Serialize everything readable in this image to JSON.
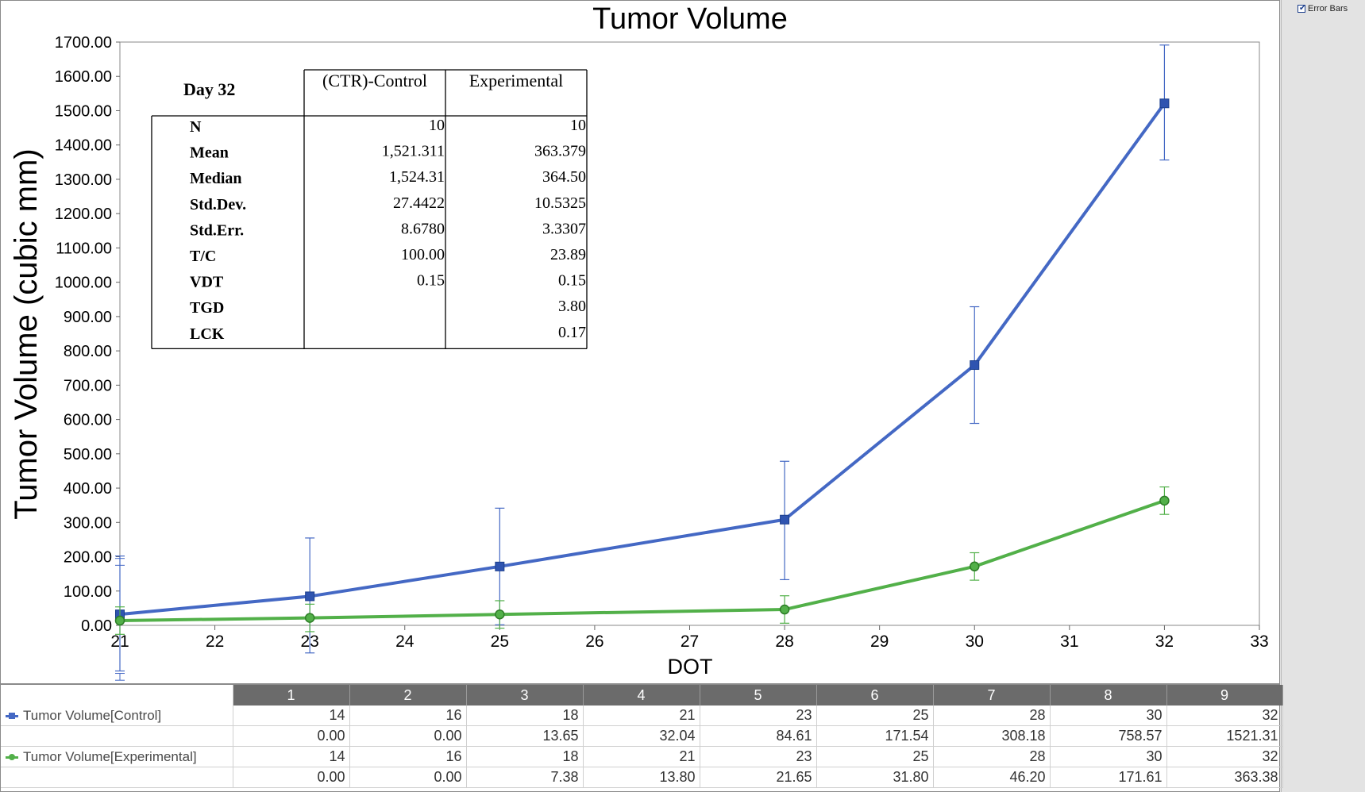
{
  "chart_data": {
    "type": "line",
    "title": "Tumor Volume",
    "xlabel": "DOT",
    "ylabel": "Tumor Volume (cubic mm)",
    "xlim": [
      21,
      33
    ],
    "ylim": [
      0,
      1700
    ],
    "x_ticks": [
      "21",
      "22",
      "23",
      "24",
      "25",
      "26",
      "27",
      "28",
      "29",
      "30",
      "31",
      "32",
      "33"
    ],
    "y_ticks": [
      "0.00",
      "100.00",
      "200.00",
      "300.00",
      "400.00",
      "500.00",
      "600.00",
      "700.00",
      "800.00",
      "900.00",
      "1000.00",
      "1100.00",
      "1200.00",
      "1300.00",
      "1400.00",
      "1500.00",
      "1600.00",
      "1700.00"
    ],
    "grid": false,
    "series": [
      {
        "name": "Tumor Volume[Control]",
        "color": "#4468c4",
        "marker": "square",
        "x": [
          21,
          23,
          25,
          28,
          30,
          32
        ],
        "y": [
          32.04,
          84.61,
          171.54,
          308.18,
          758.57,
          1521.31
        ],
        "error_bars": [
          [
            -165,
            170
          ],
          [
            -165,
            170
          ],
          [
            -170,
            170
          ],
          [
            -175,
            170
          ],
          [
            -170,
            170
          ],
          [
            -165,
            170
          ]
        ]
      },
      {
        "name": "Tumor Volume[Experimental]",
        "color": "#52b049",
        "marker": "circle",
        "x": [
          21,
          23,
          25,
          28,
          30,
          32
        ],
        "y": [
          13.8,
          21.65,
          31.8,
          46.2,
          171.61,
          363.38
        ],
        "error_bars": [
          [
            -40,
            40
          ],
          [
            -40,
            40
          ],
          [
            -40,
            40
          ],
          [
            -40,
            40
          ],
          [
            -40,
            40
          ],
          [
            -40,
            40
          ]
        ]
      }
    ],
    "extra_error_bars_at_x21": [
      {
        "y": 185,
        "err": [
          -10,
          10
        ]
      },
      {
        "y": -150,
        "err": [
          -10,
          10
        ]
      }
    ]
  },
  "stats_table": {
    "title": "Day 32",
    "columns": [
      "(CTR)-Control",
      "Experimental"
    ],
    "rows": [
      {
        "label": "N",
        "values": [
          "10",
          "10"
        ]
      },
      {
        "label": "Mean",
        "values": [
          "1,521.311",
          "363.379"
        ]
      },
      {
        "label": "Median",
        "values": [
          "1,524.31",
          "364.50"
        ]
      },
      {
        "label": "Std.Dev.",
        "values": [
          "27.4422",
          "10.5325"
        ]
      },
      {
        "label": "Std.Err.",
        "values": [
          "8.6780",
          "3.3307"
        ]
      },
      {
        "label": "T/C",
        "values": [
          "100.00",
          "23.89"
        ]
      },
      {
        "label": "VDT",
        "values": [
          "0.15",
          "0.15"
        ]
      },
      {
        "label": "TGD",
        "values": [
          "",
          "3.80"
        ]
      },
      {
        "label": "LCK",
        "values": [
          "",
          "0.17"
        ]
      }
    ]
  },
  "controls": {
    "error_bars_label": "Error Bars",
    "error_bars_checked": true
  },
  "data_grid": {
    "columns": [
      "1",
      "2",
      "3",
      "4",
      "5",
      "6",
      "7",
      "8",
      "9"
    ],
    "rows": [
      {
        "series_label": "Tumor Volume[Control]",
        "marker": "square",
        "color": "#4468c4",
        "values": [
          "14",
          "16",
          "18",
          "21",
          "23",
          "25",
          "28",
          "30",
          "32"
        ]
      },
      {
        "series_label": "",
        "values": [
          "0.00",
          "0.00",
          "13.65",
          "32.04",
          "84.61",
          "171.54",
          "308.18",
          "758.57",
          "1521.31"
        ]
      },
      {
        "series_label": "Tumor Volume[Experimental]",
        "marker": "circle",
        "color": "#52b049",
        "values": [
          "14",
          "16",
          "18",
          "21",
          "23",
          "25",
          "28",
          "30",
          "32"
        ]
      },
      {
        "series_label": "",
        "values": [
          "0.00",
          "0.00",
          "7.38",
          "13.80",
          "21.65",
          "31.80",
          "46.20",
          "171.61",
          "363.38"
        ]
      }
    ]
  }
}
